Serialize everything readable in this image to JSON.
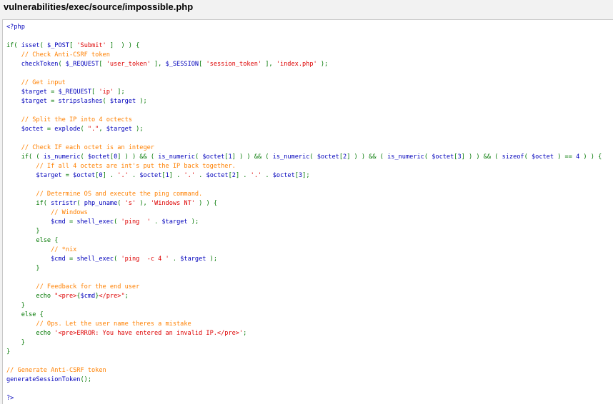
{
  "page": {
    "title": "vulnerabilities/exec/source/impossible.php"
  },
  "colors": {
    "default": "#0000bb",
    "keyword": "#007700",
    "string": "#dd0000",
    "comment": "#ff8000",
    "page_bg": "#f2f2f2",
    "panel_bg": "#ffffff"
  },
  "code": {
    "lines": [
      [
        [
          "d",
          "<?php"
        ]
      ],
      [],
      [
        [
          "k",
          "if( "
        ],
        [
          "d",
          "isset"
        ],
        [
          "k",
          "( "
        ],
        [
          "d",
          "$_POST"
        ],
        [
          "k",
          "[ "
        ],
        [
          "s",
          "'Submit'"
        ],
        [
          "k",
          " ]  ) ) {"
        ]
      ],
      [
        [
          "d",
          "    "
        ],
        [
          "c",
          "// Check Anti-CSRF token"
        ]
      ],
      [
        [
          "d",
          "    checkToken"
        ],
        [
          "k",
          "( "
        ],
        [
          "d",
          "$_REQUEST"
        ],
        [
          "k",
          "[ "
        ],
        [
          "s",
          "'user_token'"
        ],
        [
          "k",
          " ], "
        ],
        [
          "d",
          "$_SESSION"
        ],
        [
          "k",
          "[ "
        ],
        [
          "s",
          "'session_token'"
        ],
        [
          "k",
          " ], "
        ],
        [
          "s",
          "'index.php'"
        ],
        [
          "k",
          " );"
        ]
      ],
      [],
      [
        [
          "d",
          "    "
        ],
        [
          "c",
          "// Get input"
        ]
      ],
      [
        [
          "d",
          "    $target "
        ],
        [
          "k",
          "= "
        ],
        [
          "d",
          "$_REQUEST"
        ],
        [
          "k",
          "[ "
        ],
        [
          "s",
          "'ip'"
        ],
        [
          "k",
          " ];"
        ]
      ],
      [
        [
          "d",
          "    $target "
        ],
        [
          "k",
          "= "
        ],
        [
          "d",
          "stripslashes"
        ],
        [
          "k",
          "( "
        ],
        [
          "d",
          "$target "
        ],
        [
          "k",
          ");"
        ]
      ],
      [],
      [
        [
          "d",
          "    "
        ],
        [
          "c",
          "// Split the IP into 4 octects"
        ]
      ],
      [
        [
          "d",
          "    $octet "
        ],
        [
          "k",
          "= "
        ],
        [
          "d",
          "explode"
        ],
        [
          "k",
          "( "
        ],
        [
          "s",
          "\".\""
        ],
        [
          "k",
          ", "
        ],
        [
          "d",
          "$target "
        ],
        [
          "k",
          ");"
        ]
      ],
      [],
      [
        [
          "d",
          "    "
        ],
        [
          "c",
          "// Check IF each octet is an integer"
        ]
      ],
      [
        [
          "d",
          "    "
        ],
        [
          "k",
          "if( ( "
        ],
        [
          "d",
          "is_numeric"
        ],
        [
          "k",
          "( "
        ],
        [
          "d",
          "$octet"
        ],
        [
          "k",
          "["
        ],
        [
          "d",
          "0"
        ],
        [
          "k",
          "] ) ) && ( "
        ],
        [
          "d",
          "is_numeric"
        ],
        [
          "k",
          "( "
        ],
        [
          "d",
          "$octet"
        ],
        [
          "k",
          "["
        ],
        [
          "d",
          "1"
        ],
        [
          "k",
          "] ) ) && ( "
        ],
        [
          "d",
          "is_numeric"
        ],
        [
          "k",
          "( "
        ],
        [
          "d",
          "$octet"
        ],
        [
          "k",
          "["
        ],
        [
          "d",
          "2"
        ],
        [
          "k",
          "] ) ) && ( "
        ],
        [
          "d",
          "is_numeric"
        ],
        [
          "k",
          "( "
        ],
        [
          "d",
          "$octet"
        ],
        [
          "k",
          "["
        ],
        [
          "d",
          "3"
        ],
        [
          "k",
          "] ) ) && ( "
        ],
        [
          "d",
          "sizeof"
        ],
        [
          "k",
          "( "
        ],
        [
          "d",
          "$octet "
        ],
        [
          "k",
          ") == "
        ],
        [
          "d",
          "4 "
        ],
        [
          "k",
          ") ) {"
        ]
      ],
      [
        [
          "d",
          "        "
        ],
        [
          "c",
          "// If all 4 octets are int's put the IP back together."
        ]
      ],
      [
        [
          "d",
          "        $target "
        ],
        [
          "k",
          "= "
        ],
        [
          "d",
          "$octet"
        ],
        [
          "k",
          "["
        ],
        [
          "d",
          "0"
        ],
        [
          "k",
          "] . "
        ],
        [
          "s",
          "'.'"
        ],
        [
          "k",
          " . "
        ],
        [
          "d",
          "$octet"
        ],
        [
          "k",
          "["
        ],
        [
          "d",
          "1"
        ],
        [
          "k",
          "] . "
        ],
        [
          "s",
          "'.'"
        ],
        [
          "k",
          " . "
        ],
        [
          "d",
          "$octet"
        ],
        [
          "k",
          "["
        ],
        [
          "d",
          "2"
        ],
        [
          "k",
          "] . "
        ],
        [
          "s",
          "'.'"
        ],
        [
          "k",
          " . "
        ],
        [
          "d",
          "$octet"
        ],
        [
          "k",
          "["
        ],
        [
          "d",
          "3"
        ],
        [
          "k",
          "];"
        ]
      ],
      [],
      [
        [
          "d",
          "        "
        ],
        [
          "c",
          "// Determine OS and execute the ping command."
        ]
      ],
      [
        [
          "d",
          "        "
        ],
        [
          "k",
          "if( "
        ],
        [
          "d",
          "stristr"
        ],
        [
          "k",
          "( "
        ],
        [
          "d",
          "php_uname"
        ],
        [
          "k",
          "( "
        ],
        [
          "s",
          "'s'"
        ],
        [
          "k",
          " ), "
        ],
        [
          "s",
          "'Windows NT'"
        ],
        [
          "k",
          " ) ) {"
        ]
      ],
      [
        [
          "d",
          "            "
        ],
        [
          "c",
          "// Windows"
        ]
      ],
      [
        [
          "d",
          "            $cmd "
        ],
        [
          "k",
          "= "
        ],
        [
          "d",
          "shell_exec"
        ],
        [
          "k",
          "( "
        ],
        [
          "s",
          "'ping  '"
        ],
        [
          "k",
          " . "
        ],
        [
          "d",
          "$target "
        ],
        [
          "k",
          ");"
        ]
      ],
      [
        [
          "k",
          "        }"
        ]
      ],
      [
        [
          "k",
          "        else {"
        ]
      ],
      [
        [
          "d",
          "            "
        ],
        [
          "c",
          "// *nix"
        ]
      ],
      [
        [
          "d",
          "            $cmd "
        ],
        [
          "k",
          "= "
        ],
        [
          "d",
          "shell_exec"
        ],
        [
          "k",
          "( "
        ],
        [
          "s",
          "'ping  -c 4 '"
        ],
        [
          "k",
          " . "
        ],
        [
          "d",
          "$target "
        ],
        [
          "k",
          ");"
        ]
      ],
      [
        [
          "k",
          "        }"
        ]
      ],
      [],
      [
        [
          "d",
          "        "
        ],
        [
          "c",
          "// Feedback for the end user"
        ]
      ],
      [
        [
          "d",
          "        "
        ],
        [
          "k",
          "echo "
        ],
        [
          "s",
          "\"<pre>"
        ],
        [
          "k",
          "{"
        ],
        [
          "d",
          "$cmd"
        ],
        [
          "k",
          "}"
        ],
        [
          "s",
          "</pre>\""
        ],
        [
          "k",
          ";"
        ]
      ],
      [
        [
          "k",
          "    }"
        ]
      ],
      [
        [
          "k",
          "    else {"
        ]
      ],
      [
        [
          "d",
          "        "
        ],
        [
          "c",
          "// Ops. Let the user name theres a mistake"
        ]
      ],
      [
        [
          "d",
          "        "
        ],
        [
          "k",
          "echo "
        ],
        [
          "s",
          "'<pre>ERROR: You have entered an invalid IP.</pre>'"
        ],
        [
          "k",
          ";"
        ]
      ],
      [
        [
          "k",
          "    }"
        ]
      ],
      [
        [
          "k",
          "}"
        ]
      ],
      [],
      [
        [
          "c",
          "// Generate Anti-CSRF token"
        ]
      ],
      [
        [
          "d",
          "generateSessionToken"
        ],
        [
          "k",
          "();"
        ]
      ],
      [],
      [
        [
          "d",
          "?>"
        ]
      ]
    ]
  }
}
